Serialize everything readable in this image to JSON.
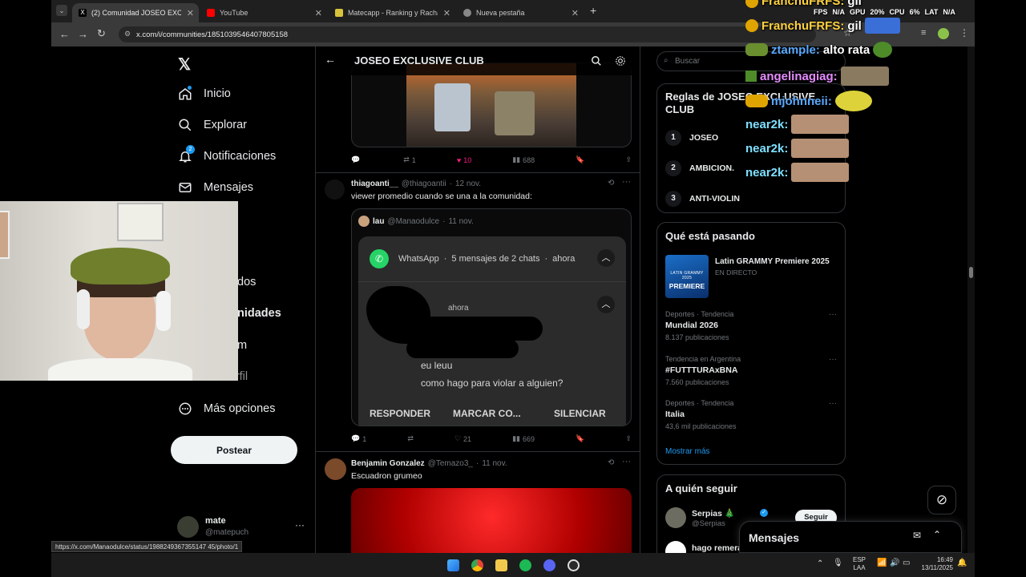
{
  "browser": {
    "tabs": [
      {
        "title": "(2) Comunidad JOSEO EXCLUSI",
        "active": true
      },
      {
        "title": "YouTube",
        "active": false
      },
      {
        "title": "Matecapp - Ranking y Racha de",
        "active": false
      },
      {
        "title": "Nueva pestaña",
        "active": false
      }
    ],
    "url": "x.com/i/communities/1851039546407805158",
    "status_url": "https://x.com/Manaodulce/status/1988249367355147 45/photo/1"
  },
  "nav": {
    "items": [
      {
        "label": "Inicio",
        "icon": "home-icon"
      },
      {
        "label": "Explorar",
        "icon": "search-icon"
      },
      {
        "label": "Notificaciones",
        "icon": "bell-icon",
        "badge": "2"
      },
      {
        "label": "Mensajes",
        "icon": "mail-icon"
      },
      {
        "label": "dos"
      },
      {
        "label": "nidades"
      },
      {
        "label": "m"
      },
      {
        "label": "Perfil"
      },
      {
        "label": "Más opciones",
        "icon": "more-options-icon"
      }
    ],
    "post_button": "Postear",
    "account": {
      "name": "mate",
      "handle": "@matepuch"
    }
  },
  "header": {
    "title": "JOSEO EXCLUSIVE CLUB"
  },
  "feed": {
    "first_post_stats": {
      "replies": "",
      "reposts": "1",
      "likes": "10",
      "views": "688"
    },
    "post1": {
      "name": "thiagoanti__",
      "handle": "@thiagoantii",
      "date": "12 nov.",
      "text": "viewer promedio cuando se una a la comunidad:",
      "quote": {
        "name": "lau",
        "handle": "@Manaodulce",
        "date": "11 nov.",
        "wa_app": "WhatsApp",
        "wa_summary": "5 mensajes de 2 chats",
        "wa_time": "ahora",
        "wa_msg_time": "ahora",
        "wa_line1": "eu leuu",
        "wa_line2": "como hago para violar a alguien?",
        "wa_actions": [
          "RESPONDER",
          "MARCAR CO...",
          "SILENCIAR"
        ]
      },
      "stats": {
        "replies": "1",
        "reposts": "",
        "likes": "21",
        "views": "669"
      }
    },
    "post2": {
      "name": "Benjamin Gonzalez",
      "handle": "@Temazo3_",
      "date": "11 nov.",
      "text": "Escuadron grumeo"
    }
  },
  "right": {
    "search_placeholder": "Buscar",
    "rules": {
      "title": "Reglas de JOSEO EXCLUSIVE CLUB",
      "items": [
        {
          "n": "1",
          "text": "JOSEO"
        },
        {
          "n": "2",
          "text": "AMBICION."
        },
        {
          "n": "3",
          "text": "ANTI-VIOLIN"
        }
      ]
    },
    "trending": {
      "title": "Qué está pasando",
      "featured": {
        "name": "Latin GRAMMY Premiere 2025",
        "status": "EN DIRECTO",
        "image_text_small": "LATIN GRAMMY 2025",
        "image_text": "PREMIERE"
      },
      "items": [
        {
          "meta": "Deportes · Tendencia",
          "name": "Mundial 2026",
          "count": "8.137 publicaciones"
        },
        {
          "meta": "Tendencia en Argentina",
          "name": "#FUTTTURAxBNA",
          "count": "7.560 publicaciones"
        },
        {
          "meta": "Deportes · Tendencia",
          "name": "Italia",
          "count": "43,6 mil publicaciones"
        }
      ],
      "show_more": "Mostrar más"
    },
    "follow": {
      "title": "A quién seguir",
      "items": [
        {
          "name": "Serpias 🎄",
          "handle": "@Serpias",
          "button": "Seguir"
        },
        {
          "name": "hago remera",
          "handle": ""
        }
      ]
    },
    "messages_title": "Mensajes"
  },
  "overlay": {
    "perf": {
      "fps_label": "FPS",
      "fps": "N/A",
      "gpu_label": "GPU",
      "gpu": "20%",
      "cpu_label": "CPU",
      "cpu": "6%",
      "lat_label": "LAT",
      "lat": "N/A"
    },
    "chat": [
      {
        "user": "FranchuFRFS:",
        "msg": "gil",
        "color": "#ffd23f"
      },
      {
        "user": "FranchuFRFS:",
        "msg": "gil",
        "color": "#ffd23f"
      },
      {
        "user": "ztample:",
        "msg": "alto rata",
        "color": "#5aa9ff"
      },
      {
        "user": "angelinagiag:",
        "msg": "",
        "color": "#e58cff"
      },
      {
        "user": "mjohnneii:",
        "msg": "",
        "color": "#5aa9ff"
      },
      {
        "user": "near2k:",
        "msg": "",
        "color": "#7ee0ff"
      },
      {
        "user": "near2k:",
        "msg": "",
        "color": "#7ee0ff"
      },
      {
        "user": "near2k:",
        "msg": "",
        "color": "#7ee0ff"
      }
    ]
  },
  "taskbar": {
    "lang1": "ESP",
    "lang2": "LAA",
    "time": "16:49",
    "date": "13/11/2025"
  }
}
